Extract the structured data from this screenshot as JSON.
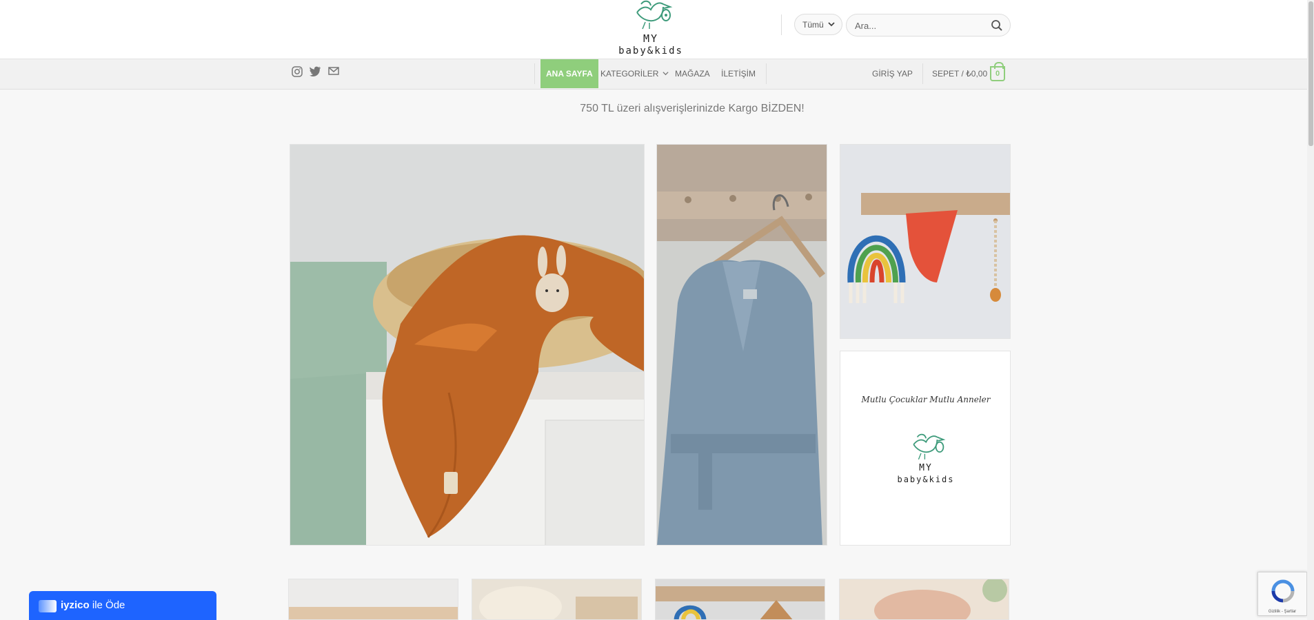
{
  "brand": {
    "my": "MY",
    "babykids": "baby&kids"
  },
  "search": {
    "category_label": "Tümü",
    "placeholder": "Ara..."
  },
  "social": {
    "icons": [
      "instagram-icon",
      "twitter-icon",
      "envelope-icon"
    ]
  },
  "nav": {
    "home": "ANA SAYFA",
    "categories": "KATEGORİLER",
    "store": "MAĞAZA",
    "contact": "İLETİŞİM",
    "login": "GİRİŞ YAP",
    "cart": "SEPET / ₺0,00",
    "cart_count": "0"
  },
  "promo": {
    "text": "750 TL üzeri alışverişlerinizde Kargo BİZDEN!"
  },
  "banner": {
    "slogan": "Mutlu Çocuklar Mutlu Anneler",
    "my": "MY",
    "babykids": "baby&kids"
  },
  "iyzico": {
    "brand": "iyzico",
    "suffix": "ile Öde"
  },
  "recaptcha": {
    "footer": "Gizlilik - Şartlar"
  },
  "colors": {
    "accent": "#8fce7c",
    "logo_green": "#3e9b7b",
    "iyzico_blue": "#1e64ff"
  }
}
